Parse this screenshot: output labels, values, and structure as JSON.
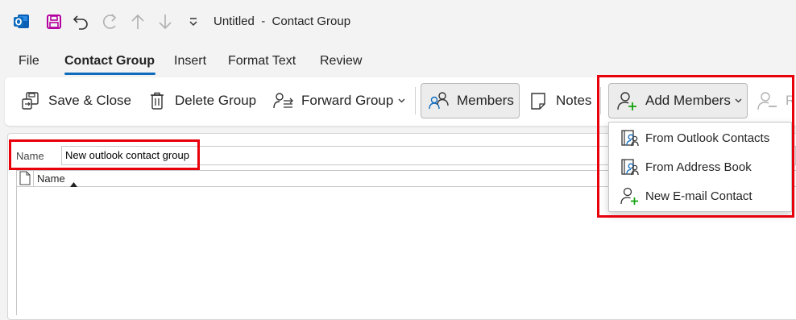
{
  "window": {
    "title": "Untitled  -  Contact Group"
  },
  "quick_access": {
    "icons": [
      "outlook-logo-icon",
      "save-icon",
      "undo-icon",
      "redo-icon",
      "previous-item-icon",
      "next-item-icon",
      "customize-toolbar-icon"
    ]
  },
  "menu": {
    "tabs": [
      {
        "label": "File"
      },
      {
        "label": "Contact Group",
        "active": true
      },
      {
        "label": "Insert"
      },
      {
        "label": "Format Text"
      },
      {
        "label": "Review"
      }
    ]
  },
  "ribbon": {
    "save_close": "Save & Close",
    "delete_group": "Delete Group",
    "forward_group": "Forward Group",
    "members": "Members",
    "notes": "Notes",
    "add_members": "Add Members",
    "remove_partial": "R"
  },
  "form": {
    "name_label": "Name",
    "name_value": "New outlook contact group",
    "column_name": "Name"
  },
  "add_members_menu": {
    "items": [
      {
        "label": "From Outlook Contacts",
        "icon": "address-book-icon"
      },
      {
        "label": "From Address Book",
        "icon": "address-book-icon"
      },
      {
        "label": "New E-mail Contact",
        "icon": "add-person-icon"
      }
    ]
  },
  "colors": {
    "accent": "#0f6cbd",
    "highlight": "#e8000b",
    "save_icon": "#b4009e",
    "add_green": "#13a10e"
  }
}
